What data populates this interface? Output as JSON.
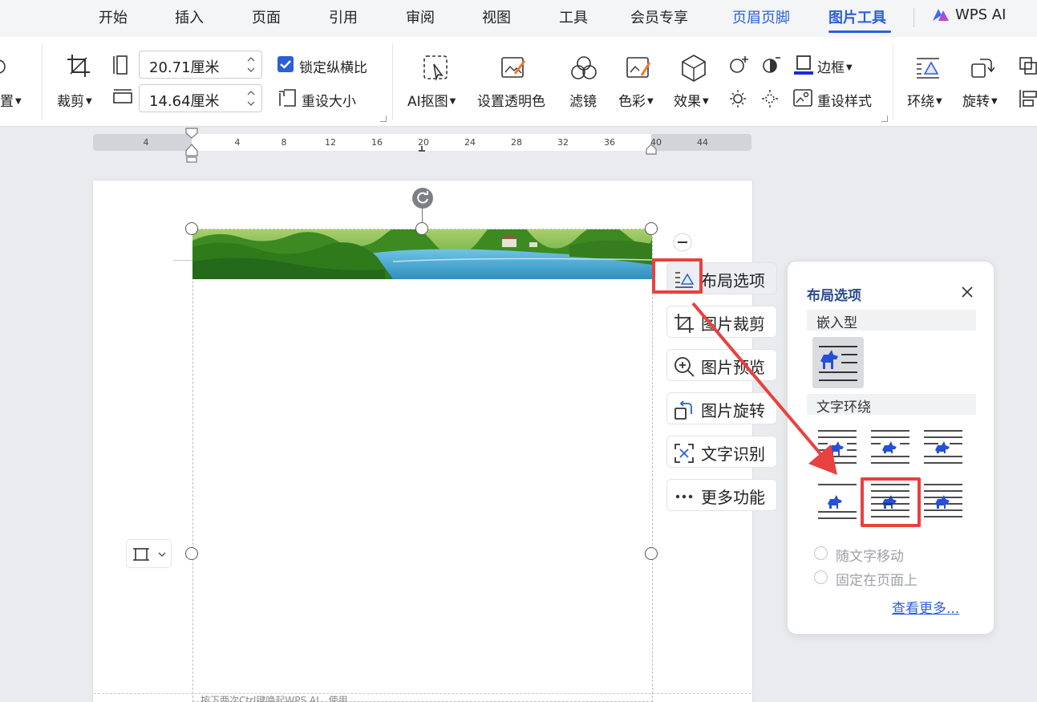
{
  "menubar": {
    "tabs": [
      {
        "label": "开始"
      },
      {
        "label": "插入"
      },
      {
        "label": "页面"
      },
      {
        "label": "引用"
      },
      {
        "label": "审阅"
      },
      {
        "label": "视图"
      },
      {
        "label": "工具"
      },
      {
        "label": "会员专享"
      },
      {
        "label": "页眉页脚"
      },
      {
        "label": "图片工具"
      }
    ],
    "active_tab": "图片工具",
    "wps_ai": "WPS AI"
  },
  "ribbon": {
    "partial_left_label": "置",
    "crop_label": "裁剪",
    "width_value": "20.71厘米",
    "height_value": "14.64厘米",
    "lock_ratio_label": "锁定纵横比",
    "lock_ratio_checked": true,
    "reset_size_label": "重设大小",
    "ai_cutout_label": "AI抠图",
    "transparent_label": "设置透明色",
    "filter_label": "滤镜",
    "color_label": "色彩",
    "effect_label": "效果",
    "border_label": "边框",
    "reset_style_label": "重设样式",
    "wrap_label": "环绕",
    "rotate_label": "旋转"
  },
  "ruler": {
    "ticks": [
      "4",
      "4",
      "8",
      "12",
      "16",
      "20",
      "24",
      "28",
      "32",
      "36",
      "40",
      "44"
    ]
  },
  "side_menu": {
    "layout_options": "布局选项",
    "crop_image": "图片裁剪",
    "preview_image": "图片预览",
    "rotate_image": "图片旋转",
    "text_recognition": "文字识别",
    "more_functions": "更多功能"
  },
  "layout_popup": {
    "title": "布局选项",
    "section_inline": "嵌入型",
    "section_wrap": "文字环绕",
    "selected_option": "wrap-option-5",
    "radio_move_with_text": "随文字移动",
    "radio_fix_on_page": "固定在页面上",
    "see_more": "查看更多..."
  },
  "bottom_hint": "按下两次Ctrl键唤起WPS AI，使用",
  "colors": {
    "accent": "#2b5fd8",
    "highlight_red": "#e8413f",
    "popup_title": "#2d4b8c"
  }
}
